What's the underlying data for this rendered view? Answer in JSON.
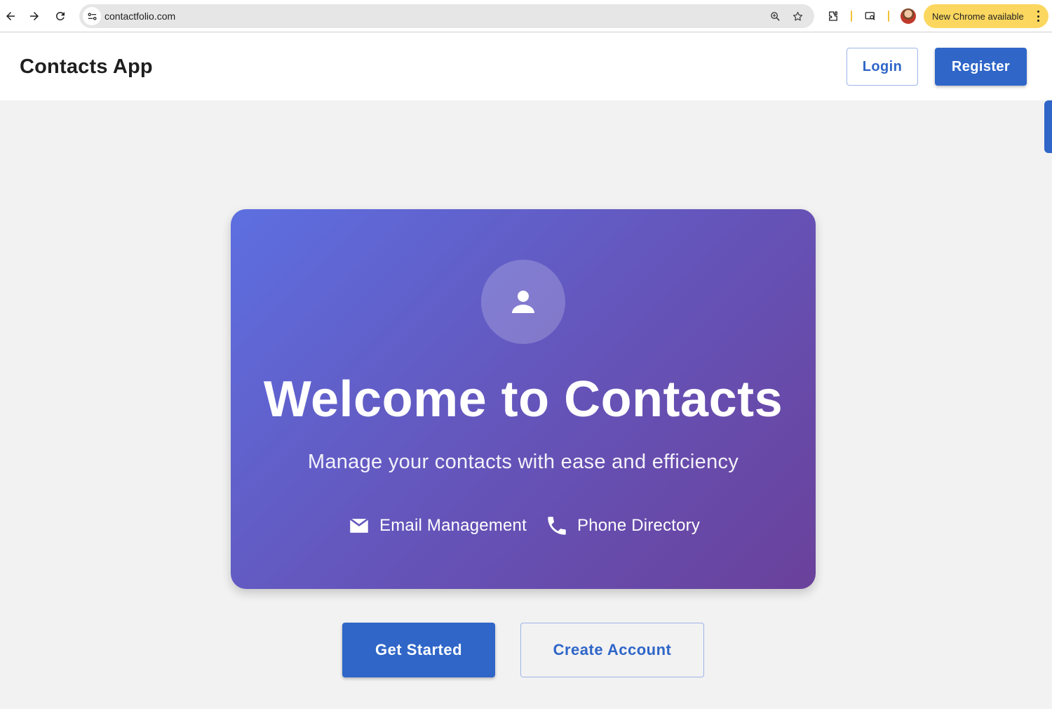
{
  "browser": {
    "url": "contactfolio.com",
    "update_label": "New Chrome available",
    "accent_update": "#fbd75f"
  },
  "header": {
    "title": "Contacts App",
    "login_label": "Login",
    "register_label": "Register"
  },
  "hero": {
    "avatar_icon": "person-icon",
    "title": "Welcome to Contacts",
    "subtitle": "Manage your contacts with ease and efficiency",
    "features": [
      {
        "icon": "email-icon",
        "label": "Email Management"
      },
      {
        "icon": "phone-icon",
        "label": "Phone Directory"
      }
    ],
    "gradient_start": "#5d6fe0",
    "gradient_end": "#6a419b"
  },
  "actions": {
    "get_started_label": "Get Started",
    "create_account_label": "Create Account"
  },
  "colors": {
    "primary": "#2f66c8",
    "background": "#f2f2f2"
  }
}
